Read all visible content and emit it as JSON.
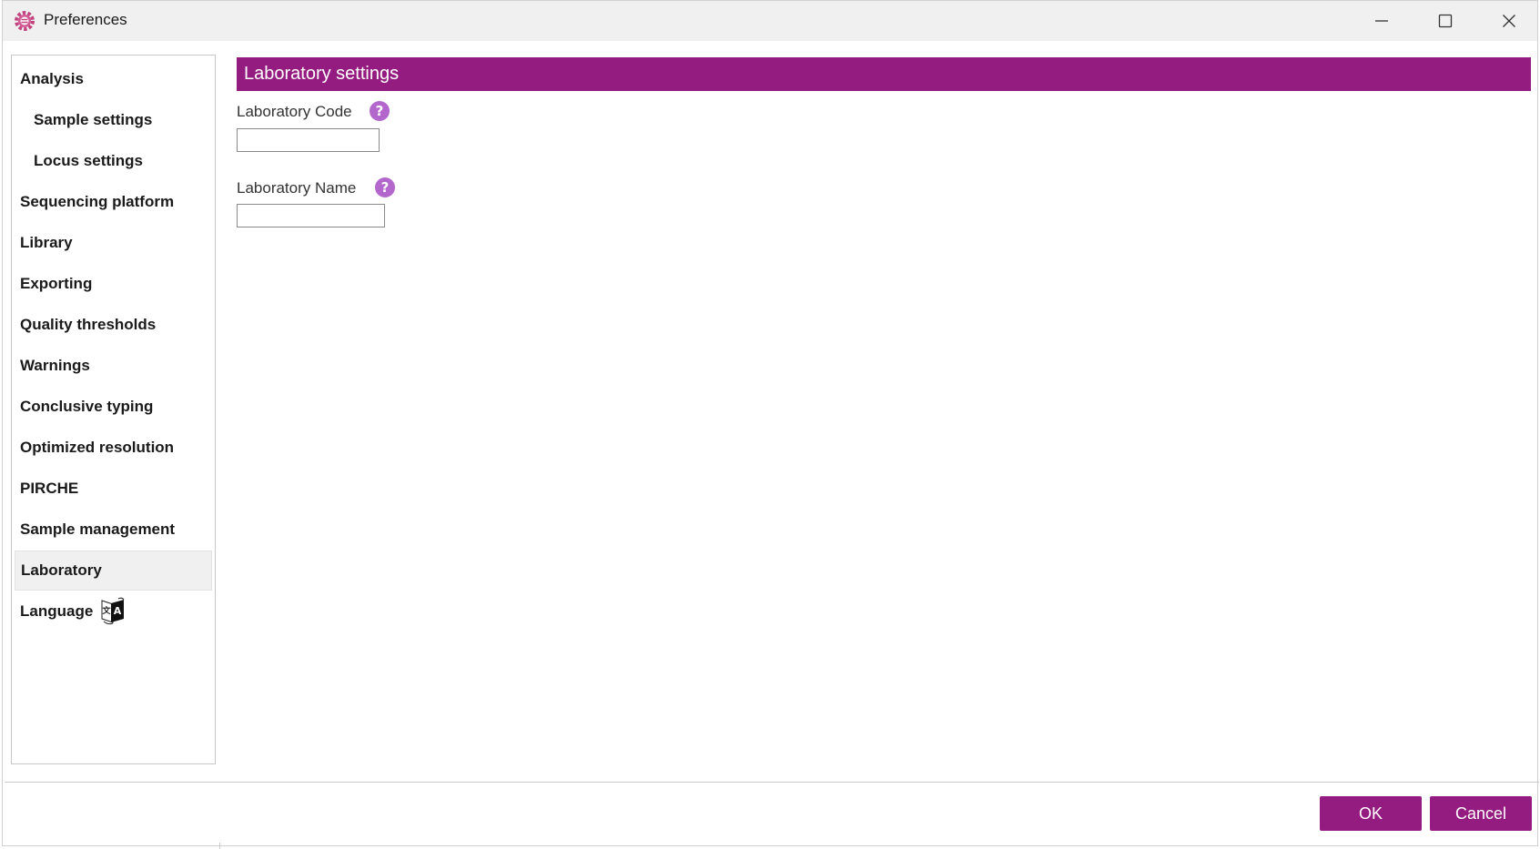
{
  "window": {
    "title": "Preferences",
    "accent_color": "#941b80",
    "controls": {
      "minimize_icon": "minimize-icon",
      "maximize_icon": "maximize-icon",
      "close_icon": "close-icon"
    }
  },
  "sidebar": {
    "items": [
      {
        "label": "Analysis",
        "level": 0,
        "selected": false
      },
      {
        "label": "Sample settings",
        "level": 1,
        "selected": false
      },
      {
        "label": "Locus settings",
        "level": 1,
        "selected": false
      },
      {
        "label": "Sequencing platform",
        "level": 0,
        "selected": false
      },
      {
        "label": "Library",
        "level": 0,
        "selected": false
      },
      {
        "label": "Exporting",
        "level": 0,
        "selected": false
      },
      {
        "label": "Quality thresholds",
        "level": 0,
        "selected": false
      },
      {
        "label": "Warnings",
        "level": 0,
        "selected": false
      },
      {
        "label": "Conclusive typing",
        "level": 0,
        "selected": false
      },
      {
        "label": "Optimized resolution",
        "level": 0,
        "selected": false
      },
      {
        "label": "PIRCHE",
        "level": 0,
        "selected": false
      },
      {
        "label": "Sample management",
        "level": 0,
        "selected": false
      },
      {
        "label": "Laboratory",
        "level": 0,
        "selected": true
      },
      {
        "label": "Language",
        "level": 0,
        "selected": false,
        "icon": "translate-icon"
      }
    ]
  },
  "main": {
    "section_title": "Laboratory settings",
    "fields": [
      {
        "label": "Laboratory Code",
        "value": "",
        "help": "?"
      },
      {
        "label": "Laboratory Name",
        "value": "",
        "help": "?"
      }
    ]
  },
  "footer": {
    "ok_label": "OK",
    "cancel_label": "Cancel"
  }
}
